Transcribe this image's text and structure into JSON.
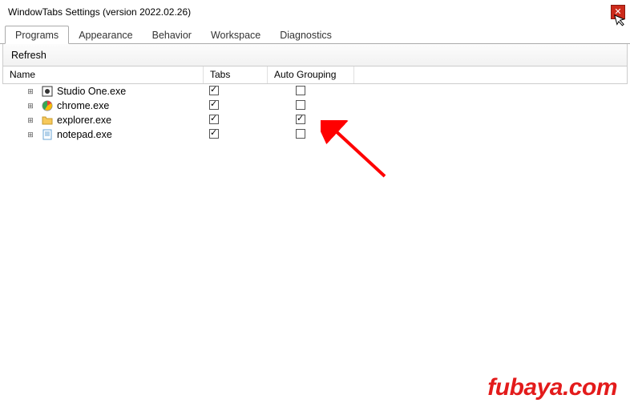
{
  "window": {
    "title": "WindowTabs Settings (version 2022.02.26)"
  },
  "tabs": {
    "programs": "Programs",
    "appearance": "Appearance",
    "behavior": "Behavior",
    "workspace": "Workspace",
    "diagnostics": "Diagnostics",
    "active": "programs"
  },
  "toolbar": {
    "refresh": "Refresh"
  },
  "columns": {
    "name": "Name",
    "tabs": "Tabs",
    "auto": "Auto Grouping"
  },
  "rows": [
    {
      "icon": "studio",
      "name": "Studio One.exe",
      "tabs": true,
      "auto": false
    },
    {
      "icon": "chrome",
      "name": "chrome.exe",
      "tabs": true,
      "auto": false
    },
    {
      "icon": "explorer",
      "name": "explorer.exe",
      "tabs": true,
      "auto": true
    },
    {
      "icon": "notepad",
      "name": "notepad.exe",
      "tabs": true,
      "auto": false
    }
  ],
  "watermark": "fubaya.com"
}
